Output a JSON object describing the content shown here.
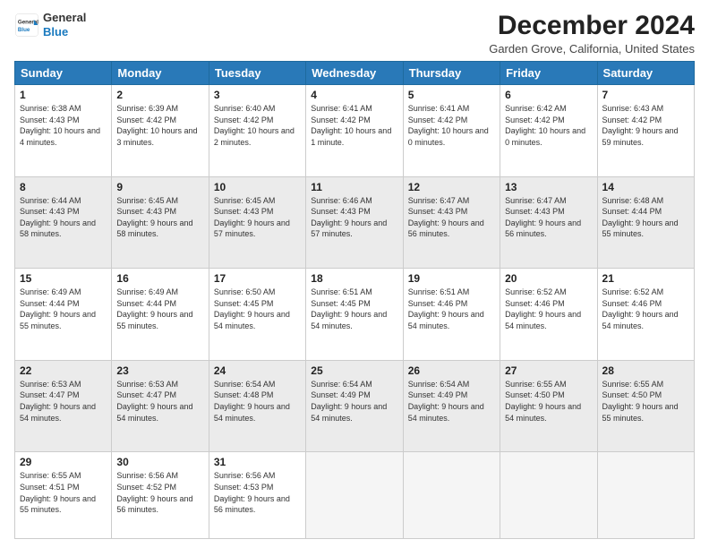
{
  "header": {
    "logo_line1": "General",
    "logo_line2": "Blue",
    "month": "December 2024",
    "location": "Garden Grove, California, United States"
  },
  "weekdays": [
    "Sunday",
    "Monday",
    "Tuesday",
    "Wednesday",
    "Thursday",
    "Friday",
    "Saturday"
  ],
  "weeks": [
    [
      {
        "day": "1",
        "sunrise": "Sunrise: 6:38 AM",
        "sunset": "Sunset: 4:43 PM",
        "daylight": "Daylight: 10 hours and 4 minutes."
      },
      {
        "day": "2",
        "sunrise": "Sunrise: 6:39 AM",
        "sunset": "Sunset: 4:42 PM",
        "daylight": "Daylight: 10 hours and 3 minutes."
      },
      {
        "day": "3",
        "sunrise": "Sunrise: 6:40 AM",
        "sunset": "Sunset: 4:42 PM",
        "daylight": "Daylight: 10 hours and 2 minutes."
      },
      {
        "day": "4",
        "sunrise": "Sunrise: 6:41 AM",
        "sunset": "Sunset: 4:42 PM",
        "daylight": "Daylight: 10 hours and 1 minute."
      },
      {
        "day": "5",
        "sunrise": "Sunrise: 6:41 AM",
        "sunset": "Sunset: 4:42 PM",
        "daylight": "Daylight: 10 hours and 0 minutes."
      },
      {
        "day": "6",
        "sunrise": "Sunrise: 6:42 AM",
        "sunset": "Sunset: 4:42 PM",
        "daylight": "Daylight: 10 hours and 0 minutes."
      },
      {
        "day": "7",
        "sunrise": "Sunrise: 6:43 AM",
        "sunset": "Sunset: 4:42 PM",
        "daylight": "Daylight: 9 hours and 59 minutes."
      }
    ],
    [
      {
        "day": "8",
        "sunrise": "Sunrise: 6:44 AM",
        "sunset": "Sunset: 4:43 PM",
        "daylight": "Daylight: 9 hours and 58 minutes."
      },
      {
        "day": "9",
        "sunrise": "Sunrise: 6:45 AM",
        "sunset": "Sunset: 4:43 PM",
        "daylight": "Daylight: 9 hours and 58 minutes."
      },
      {
        "day": "10",
        "sunrise": "Sunrise: 6:45 AM",
        "sunset": "Sunset: 4:43 PM",
        "daylight": "Daylight: 9 hours and 57 minutes."
      },
      {
        "day": "11",
        "sunrise": "Sunrise: 6:46 AM",
        "sunset": "Sunset: 4:43 PM",
        "daylight": "Daylight: 9 hours and 57 minutes."
      },
      {
        "day": "12",
        "sunrise": "Sunrise: 6:47 AM",
        "sunset": "Sunset: 4:43 PM",
        "daylight": "Daylight: 9 hours and 56 minutes."
      },
      {
        "day": "13",
        "sunrise": "Sunrise: 6:47 AM",
        "sunset": "Sunset: 4:43 PM",
        "daylight": "Daylight: 9 hours and 56 minutes."
      },
      {
        "day": "14",
        "sunrise": "Sunrise: 6:48 AM",
        "sunset": "Sunset: 4:44 PM",
        "daylight": "Daylight: 9 hours and 55 minutes."
      }
    ],
    [
      {
        "day": "15",
        "sunrise": "Sunrise: 6:49 AM",
        "sunset": "Sunset: 4:44 PM",
        "daylight": "Daylight: 9 hours and 55 minutes."
      },
      {
        "day": "16",
        "sunrise": "Sunrise: 6:49 AM",
        "sunset": "Sunset: 4:44 PM",
        "daylight": "Daylight: 9 hours and 55 minutes."
      },
      {
        "day": "17",
        "sunrise": "Sunrise: 6:50 AM",
        "sunset": "Sunset: 4:45 PM",
        "daylight": "Daylight: 9 hours and 54 minutes."
      },
      {
        "day": "18",
        "sunrise": "Sunrise: 6:51 AM",
        "sunset": "Sunset: 4:45 PM",
        "daylight": "Daylight: 9 hours and 54 minutes."
      },
      {
        "day": "19",
        "sunrise": "Sunrise: 6:51 AM",
        "sunset": "Sunset: 4:46 PM",
        "daylight": "Daylight: 9 hours and 54 minutes."
      },
      {
        "day": "20",
        "sunrise": "Sunrise: 6:52 AM",
        "sunset": "Sunset: 4:46 PM",
        "daylight": "Daylight: 9 hours and 54 minutes."
      },
      {
        "day": "21",
        "sunrise": "Sunrise: 6:52 AM",
        "sunset": "Sunset: 4:46 PM",
        "daylight": "Daylight: 9 hours and 54 minutes."
      }
    ],
    [
      {
        "day": "22",
        "sunrise": "Sunrise: 6:53 AM",
        "sunset": "Sunset: 4:47 PM",
        "daylight": "Daylight: 9 hours and 54 minutes."
      },
      {
        "day": "23",
        "sunrise": "Sunrise: 6:53 AM",
        "sunset": "Sunset: 4:47 PM",
        "daylight": "Daylight: 9 hours and 54 minutes."
      },
      {
        "day": "24",
        "sunrise": "Sunrise: 6:54 AM",
        "sunset": "Sunset: 4:48 PM",
        "daylight": "Daylight: 9 hours and 54 minutes."
      },
      {
        "day": "25",
        "sunrise": "Sunrise: 6:54 AM",
        "sunset": "Sunset: 4:49 PM",
        "daylight": "Daylight: 9 hours and 54 minutes."
      },
      {
        "day": "26",
        "sunrise": "Sunrise: 6:54 AM",
        "sunset": "Sunset: 4:49 PM",
        "daylight": "Daylight: 9 hours and 54 minutes."
      },
      {
        "day": "27",
        "sunrise": "Sunrise: 6:55 AM",
        "sunset": "Sunset: 4:50 PM",
        "daylight": "Daylight: 9 hours and 54 minutes."
      },
      {
        "day": "28",
        "sunrise": "Sunrise: 6:55 AM",
        "sunset": "Sunset: 4:50 PM",
        "daylight": "Daylight: 9 hours and 55 minutes."
      }
    ],
    [
      {
        "day": "29",
        "sunrise": "Sunrise: 6:55 AM",
        "sunset": "Sunset: 4:51 PM",
        "daylight": "Daylight: 9 hours and 55 minutes."
      },
      {
        "day": "30",
        "sunrise": "Sunrise: 6:56 AM",
        "sunset": "Sunset: 4:52 PM",
        "daylight": "Daylight: 9 hours and 56 minutes."
      },
      {
        "day": "31",
        "sunrise": "Sunrise: 6:56 AM",
        "sunset": "Sunset: 4:53 PM",
        "daylight": "Daylight: 9 hours and 56 minutes."
      },
      null,
      null,
      null,
      null
    ]
  ]
}
